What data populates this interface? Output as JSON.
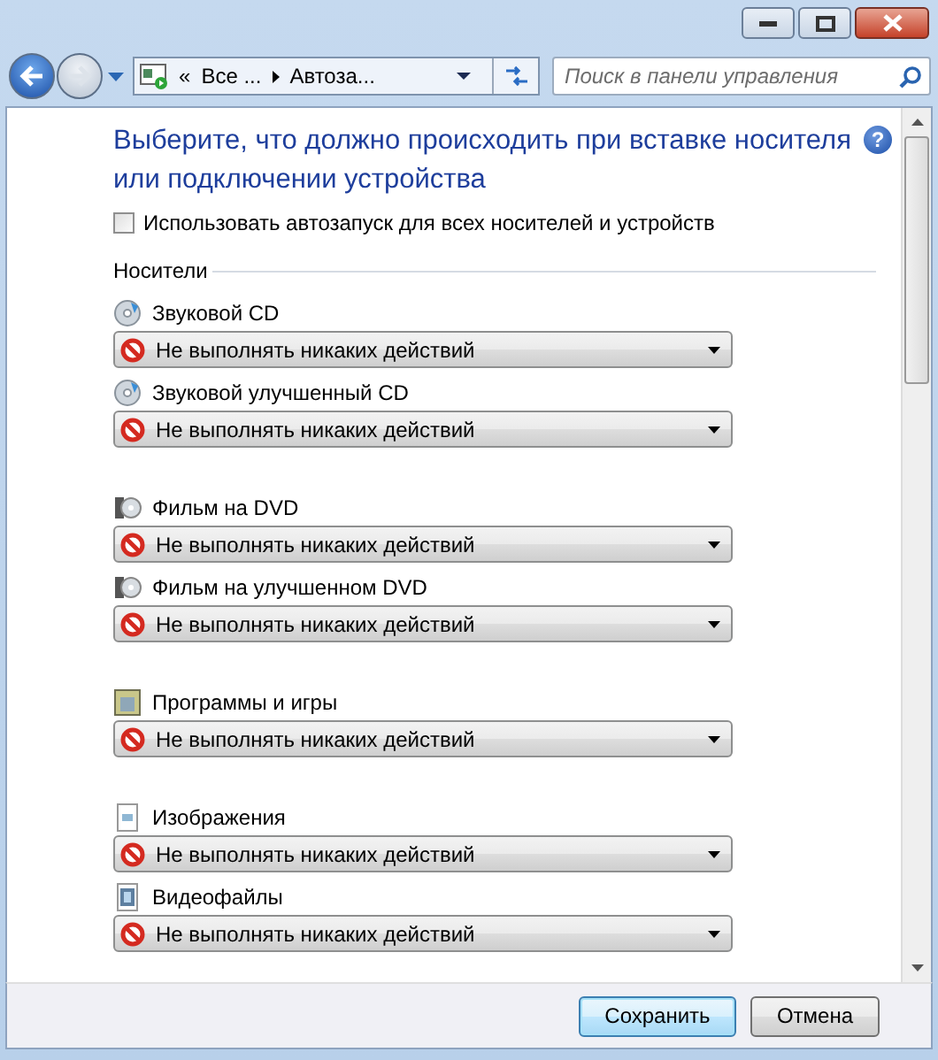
{
  "address": {
    "chevron": "«",
    "crumbs": [
      "Все ...",
      "Автоза..."
    ]
  },
  "search": {
    "placeholder": "Поиск в панели управления"
  },
  "heading": "Выберите, что должно происходить при вставке носителя или подключении устройства",
  "help": "?",
  "autoplay_all": {
    "label": "Использовать автозапуск для всех носителей и устройств",
    "checked": false
  },
  "section": "Носители",
  "groups": [
    {
      "items": [
        {
          "kind": "disc",
          "label": "Звуковой CD",
          "action": "Не выполнять никаких действий"
        },
        {
          "kind": "disc",
          "label": "Звуковой улучшенный CD",
          "action": "Не выполнять никаких действий"
        }
      ]
    },
    {
      "items": [
        {
          "kind": "dvd",
          "label": "Фильм на DVD",
          "action": "Не выполнять никаких действий"
        },
        {
          "kind": "dvd",
          "label": "Фильм на улучшенном DVD",
          "action": "Не выполнять никаких действий"
        }
      ]
    },
    {
      "items": [
        {
          "kind": "program",
          "label": "Программы и игры",
          "action": "Не выполнять никаких действий"
        }
      ]
    },
    {
      "items": [
        {
          "kind": "image",
          "label": "Изображения",
          "action": "Не выполнять никаких действий"
        },
        {
          "kind": "video",
          "label": "Видеофайлы",
          "action": "Не выполнять никаких действий"
        }
      ]
    }
  ],
  "buttons": [
    {
      "label": "Сохранить",
      "default": true
    },
    {
      "label": "Отмена",
      "default": false
    }
  ]
}
